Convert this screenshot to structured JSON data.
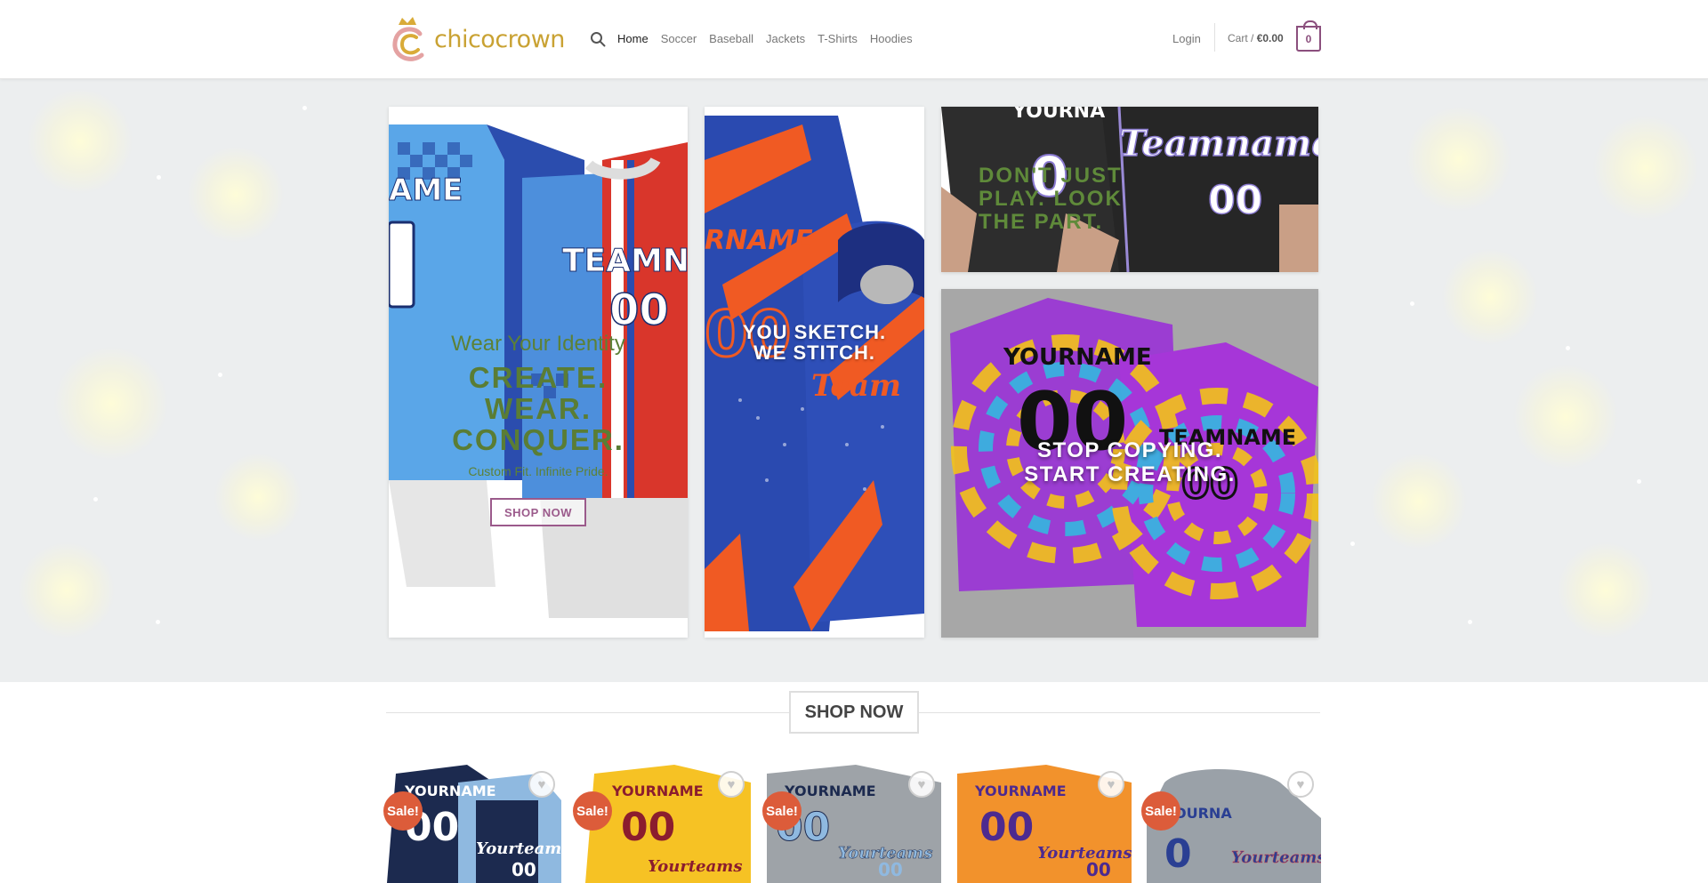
{
  "header": {
    "brand": "chicocrown",
    "nav": [
      "Home",
      "Soccer",
      "Baseball",
      "Jackets",
      "T-Shirts",
      "Hoodies"
    ],
    "login": "Login",
    "cart_label": "Cart /",
    "cart_total": "€0.00",
    "cart_count": "0"
  },
  "hero": {
    "tile1": {
      "tagline": "Wear Your Identity",
      "headline_1": "CREATE.",
      "headline_2": "WEAR.",
      "headline_3": "CONQUER.",
      "subline": "Custom Fit. Infinite Pride.",
      "button": "SHOP NOW"
    },
    "tile2": {
      "line_1": "YOU SKETCH.",
      "line_2": "WE STITCH."
    },
    "tile3": {
      "line_1": "DON'T JUST",
      "line_2": "PLAY. LOOK",
      "line_3": "THE PART."
    },
    "tile4": {
      "line_1": "STOP COPYING.",
      "line_2": "START CREATING."
    }
  },
  "shop": {
    "title": "SHOP NOW",
    "products": [
      {
        "sale": "Sale!",
        "wishlist_icon": "heart-icon"
      },
      {
        "sale": "Sale!",
        "wishlist_icon": "heart-icon"
      },
      {
        "sale": "Sale!",
        "wishlist_icon": "heart-icon"
      },
      {
        "sale": "",
        "wishlist_icon": "heart-icon"
      },
      {
        "sale": "Sale!",
        "wishlist_icon": "heart-icon"
      }
    ]
  },
  "colors": {
    "brand_gold": "#c9a233",
    "accent_purple": "#8b4f7d",
    "hero_green": "#5a7d35",
    "sale_badge": "#dc5c3a"
  }
}
